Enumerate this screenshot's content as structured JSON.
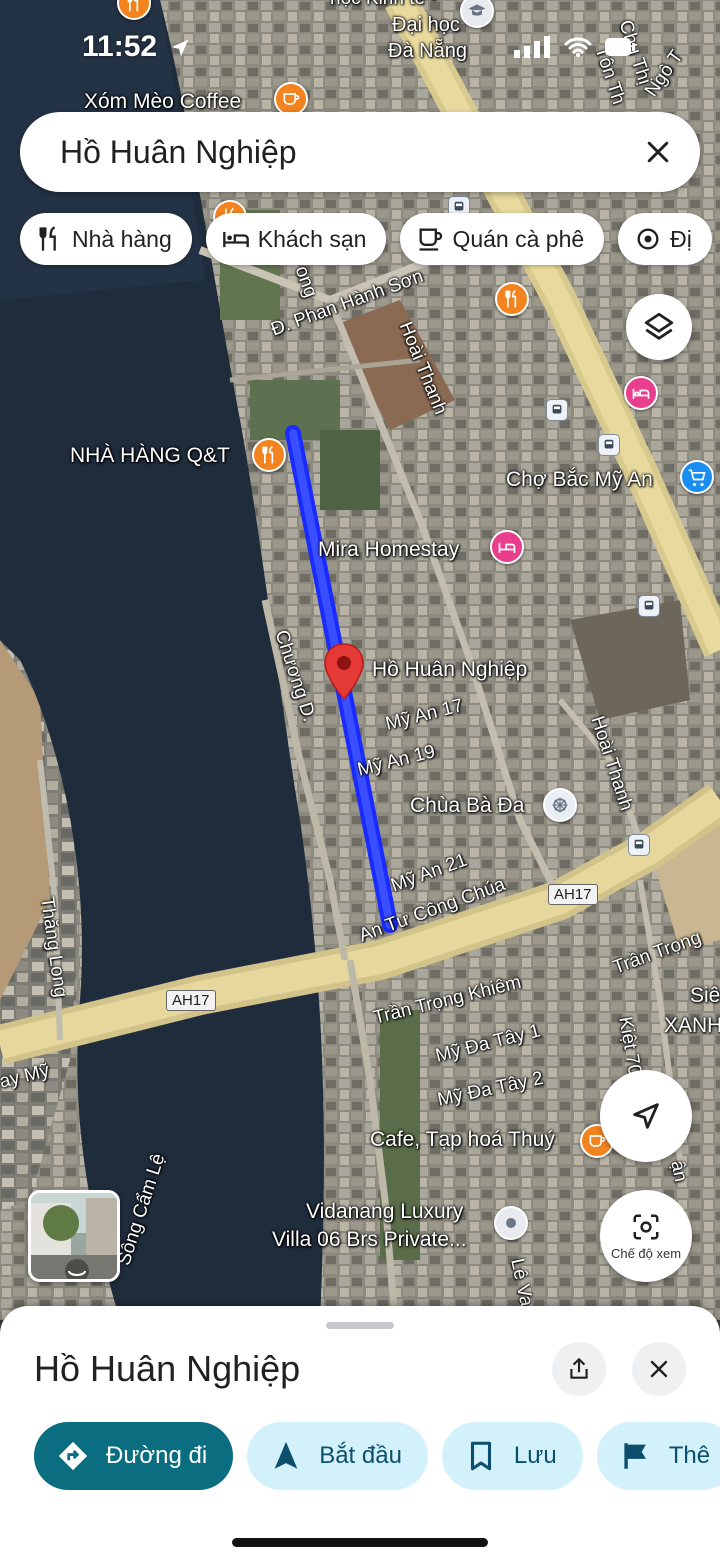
{
  "status_bar": {
    "time": "11:52"
  },
  "search": {
    "query": "Hồ Huân Nghiệp"
  },
  "chips": [
    {
      "label": "Nhà hàng",
      "icon": "restaurant-icon"
    },
    {
      "label": "Khách sạn",
      "icon": "hotel-icon"
    },
    {
      "label": "Quán cà phê",
      "icon": "coffee-icon"
    },
    {
      "label": "Đị",
      "icon": "attraction-icon"
    }
  ],
  "map": {
    "pois": {
      "xom_meo": "Xóm Mèo Coffee",
      "qt": "NHÀ HÀNG Q&T",
      "cho": "Chợ Bắc Mỹ An",
      "mira": "Mira Homestay",
      "target": "Hồ Huân Nghiệp",
      "chua": "Chùa Bà Đa",
      "cafe": "Cafe, Tạp hoá Thuý",
      "vida1": "Vidanang Luxury",
      "vida2": "Villa 06 Brs Private...",
      "daihoc1": "Đại học",
      "daihoc2": "Đà Nẵng",
      "daihoc0": "học Kinh tế -",
      "sieu": "Siê",
      "xanh": "XANH"
    },
    "streets": {
      "phan_hanh_son": "Đ. Phan Hành Sơn",
      "hoai_thanh": "Hoài Thanh",
      "hoai_thanh2": "Hoài Thanh",
      "chuong_d": "Chương D.",
      "my_an_17": "Mỹ An 17",
      "my_an_19": "Mỹ An 19",
      "my_an_21": "Mỹ An 21",
      "an_tu": "An Tư Công Chúa",
      "tran_trong_khiem": "Trần Trọng Khiêm",
      "tran_trong": "Trần Trọng",
      "my_da_tay_1": "Mỹ Đa Tây 1",
      "my_da_tay_2": "Mỹ Đa Tây 2",
      "thang_long": "Thăng Long",
      "song_cam_le": "Sông Cẩm Lệ",
      "kiet": "Kiệt 70",
      "ay_my": "ay Mỹ",
      "ngo": "Ngô T",
      "ton": "Tôn Th",
      "chu": "Chu Thị",
      "hoai_cut": "ong",
      "le_va": "Lê Va",
      "an_cut": "ận"
    },
    "shields": {
      "ah17_a": "AH17",
      "ah17_b": "AH17"
    }
  },
  "street_mode": {
    "label": "Chế độ xem"
  },
  "sheet": {
    "title": "Hồ Huân Nghiệp",
    "actions": [
      {
        "label": "Đường đi",
        "icon": "directions-icon",
        "primary": true
      },
      {
        "label": "Bắt đầu",
        "icon": "navigation-arrow-icon"
      },
      {
        "label": "Lưu",
        "icon": "bookmark-icon"
      },
      {
        "label": "Thê",
        "icon": "flag-icon"
      }
    ]
  },
  "colors": {
    "route": "#1a2bff",
    "pin": "#e53935",
    "primary_action": "#0b6e80",
    "action_bg": "#d3f1fa"
  }
}
